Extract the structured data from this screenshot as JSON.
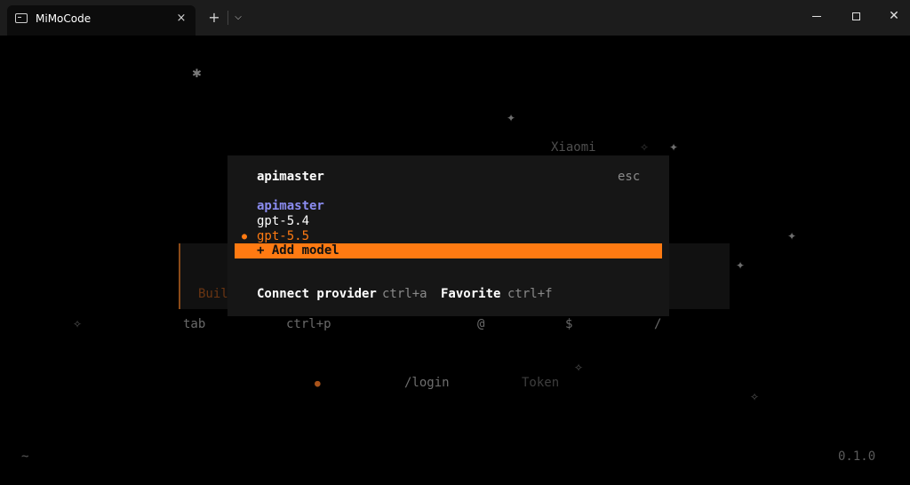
{
  "window": {
    "tab_title": "MiMoCode",
    "tab_close_icon": "×",
    "new_tab_icon": "+",
    "dropdown_icon": "⌄",
    "min_icon": "minimize-icon",
    "max_icon": "maximize-icon",
    "close_icon": "✕"
  },
  "background": {
    "xiaomi": "Xiaomi",
    "panel_text": "Buil",
    "hints": {
      "tab": "tab",
      "ctrl_p": "ctrl+p",
      "at": "@",
      "dollar": "$",
      "slash": "/"
    },
    "dot": "●",
    "login": "/login",
    "token": "Token",
    "tilde": "~",
    "version": "0.1.0",
    "stars": {
      "s1": "✱",
      "s2": "✦",
      "s3": "✧",
      "s4": "✦",
      "s5": "✦",
      "s6": "✦",
      "s7": "✧",
      "s8": "✧",
      "s9": "✧"
    }
  },
  "dialog": {
    "title": "apimaster",
    "esc": "esc",
    "provider": "apimaster",
    "models": [
      "gpt-5.4",
      "gpt-5.5"
    ],
    "current_dot": "●",
    "add_model": "+ Add model",
    "connect_label": "Connect provider",
    "connect_key": "ctrl+a",
    "favorite_label": "Favorite",
    "favorite_key": "ctrl+f"
  },
  "colors": {
    "accent": "#ff7a12",
    "provider": "#8b8cf0",
    "dim": "#5a5a5a"
  }
}
